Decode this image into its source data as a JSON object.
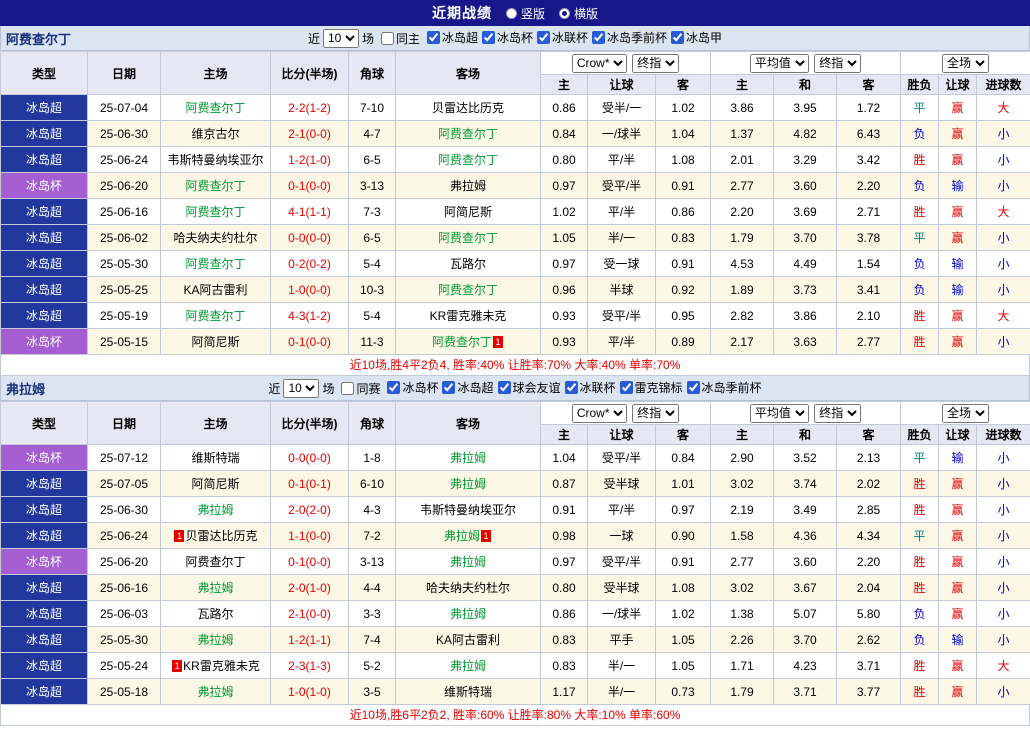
{
  "topbar": {
    "title": "近期战绩",
    "radio_vertical": "竖版",
    "radio_horizontal": "横版",
    "selected": "横版"
  },
  "table_headers": {
    "col_type": "类型",
    "col_date": "日期",
    "col_home": "主场",
    "col_score": "比分(半场)",
    "col_corner": "角球",
    "col_away": "客场",
    "grp1_select1": "Crow*",
    "grp1_select2": "终指",
    "grp1_sub": [
      "主",
      "让球",
      "客"
    ],
    "grp2_select1": "平均值",
    "grp2_select2": "终指",
    "grp2_sub": [
      "主",
      "和",
      "客"
    ],
    "grp3_select": "全场",
    "grp3_sub": [
      "胜负",
      "让球",
      "进球数"
    ]
  },
  "colors": {
    "league_super_bg": "#23389c",
    "league_cup_bg": "#a45ed2",
    "focus_team": "#009933",
    "win_red": "#e60000",
    "lose_blue": "#0000cc",
    "draw_teal": "#008080",
    "topbar_bg": "#17178a",
    "stripe_bg": "#fcf8e5"
  },
  "sections": [
    {
      "team": "阿费查尔丁",
      "filter": {
        "near_label": "近",
        "count": "10",
        "games_label": "场",
        "same_label": "同主",
        "same_checked": false,
        "leagues": [
          {
            "label": "冰岛超",
            "checked": true
          },
          {
            "label": "冰岛杯",
            "checked": true
          },
          {
            "label": "冰联杯",
            "checked": true
          },
          {
            "label": "冰岛季前杯",
            "checked": true
          },
          {
            "label": "冰岛甲",
            "checked": true
          }
        ]
      },
      "rows": [
        {
          "league": "冰岛超",
          "type": "super",
          "date": "25-07-04",
          "home": "阿费查尔丁",
          "home_focus": true,
          "score": "2-2(1-2)",
          "corners": "7-10",
          "away": "贝雷达比历克",
          "away_focus": false,
          "odds": [
            "0.86",
            "受半/一",
            "1.02"
          ],
          "avg": [
            "3.86",
            "3.95",
            "1.72"
          ],
          "results": [
            "平",
            "赢",
            "大"
          ]
        },
        {
          "league": "冰岛超",
          "type": "super",
          "date": "25-06-30",
          "home": "维京古尔",
          "home_focus": false,
          "score": "2-1(0-0)",
          "corners": "4-7",
          "away": "阿费查尔丁",
          "away_focus": true,
          "odds": [
            "0.84",
            "一/球半",
            "1.04"
          ],
          "avg": [
            "1.37",
            "4.82",
            "6.43"
          ],
          "results": [
            "负",
            "赢",
            "小"
          ]
        },
        {
          "league": "冰岛超",
          "type": "super",
          "date": "25-06-24",
          "home": "韦斯特曼纳埃亚尔",
          "home_focus": false,
          "score": "1-2(1-0)",
          "corners": "6-5",
          "away": "阿费查尔丁",
          "away_focus": true,
          "odds": [
            "0.80",
            "平/半",
            "1.08"
          ],
          "avg": [
            "2.01",
            "3.29",
            "3.42"
          ],
          "results": [
            "胜",
            "赢",
            "小"
          ]
        },
        {
          "league": "冰岛杯",
          "type": "cup",
          "date": "25-06-20",
          "home": "阿费查尔丁",
          "home_focus": true,
          "score": "0-1(0-0)",
          "corners": "3-13",
          "away": "弗拉姆",
          "away_focus": false,
          "odds": [
            "0.97",
            "受平/半",
            "0.91"
          ],
          "avg": [
            "2.77",
            "3.60",
            "2.20"
          ],
          "results": [
            "负",
            "输",
            "小"
          ]
        },
        {
          "league": "冰岛超",
          "type": "super",
          "date": "25-06-16",
          "home": "阿费查尔丁",
          "home_focus": true,
          "score": "4-1(1-1)",
          "corners": "7-3",
          "away": "阿简尼斯",
          "away_focus": false,
          "odds": [
            "1.02",
            "平/半",
            "0.86"
          ],
          "avg": [
            "2.20",
            "3.69",
            "2.71"
          ],
          "results": [
            "胜",
            "赢",
            "大"
          ]
        },
        {
          "league": "冰岛超",
          "type": "super",
          "date": "25-06-02",
          "home": "哈夫纳夫约杜尔",
          "home_focus": false,
          "score": "0-0(0-0)",
          "corners": "6-5",
          "away": "阿费查尔丁",
          "away_focus": true,
          "odds": [
            "1.05",
            "半/一",
            "0.83"
          ],
          "avg": [
            "1.79",
            "3.70",
            "3.78"
          ],
          "results": [
            "平",
            "赢",
            "小"
          ]
        },
        {
          "league": "冰岛超",
          "type": "super",
          "date": "25-05-30",
          "home": "阿费查尔丁",
          "home_focus": true,
          "score": "0-2(0-2)",
          "corners": "5-4",
          "away": "瓦路尔",
          "away_focus": false,
          "odds": [
            "0.97",
            "受一球",
            "0.91"
          ],
          "avg": [
            "4.53",
            "4.49",
            "1.54"
          ],
          "results": [
            "负",
            "输",
            "小"
          ]
        },
        {
          "league": "冰岛超",
          "type": "super",
          "date": "25-05-25",
          "home": "KA阿古雷利",
          "home_focus": false,
          "score": "1-0(0-0)",
          "corners": "10-3",
          "away": "阿费查尔丁",
          "away_focus": true,
          "odds": [
            "0.96",
            "半球",
            "0.92"
          ],
          "avg": [
            "1.89",
            "3.73",
            "3.41"
          ],
          "results": [
            "负",
            "输",
            "小"
          ]
        },
        {
          "league": "冰岛超",
          "type": "super",
          "date": "25-05-19",
          "home": "阿费查尔丁",
          "home_focus": true,
          "score": "4-3(1-2)",
          "corners": "5-4",
          "away": "KR雷克雅未克",
          "away_focus": false,
          "odds": [
            "0.93",
            "受平/半",
            "0.95"
          ],
          "avg": [
            "2.82",
            "3.86",
            "2.10"
          ],
          "results": [
            "胜",
            "赢",
            "大"
          ]
        },
        {
          "league": "冰岛杯",
          "type": "cup",
          "date": "25-05-15",
          "home": "阿简尼斯",
          "home_focus": false,
          "score": "0-1(0-0)",
          "corners": "11-3",
          "away": "阿费查尔丁",
          "away_focus": true,
          "away_badge_post": "1",
          "odds": [
            "0.93",
            "平/半",
            "0.89"
          ],
          "avg": [
            "2.17",
            "3.63",
            "2.77"
          ],
          "results": [
            "胜",
            "赢",
            "小"
          ]
        }
      ],
      "summary": "近10场,胜4平2负4, 胜率:40% 让胜率:70% 大率:40% 单率:70%"
    },
    {
      "team": "弗拉姆",
      "filter": {
        "near_label": "近",
        "count": "10",
        "games_label": "场",
        "same_label": "同赛",
        "same_checked": false,
        "leagues": [
          {
            "label": "冰岛杯",
            "checked": true
          },
          {
            "label": "冰岛超",
            "checked": true
          },
          {
            "label": "球会友谊",
            "checked": true
          },
          {
            "label": "冰联杯",
            "checked": true
          },
          {
            "label": "雷克锦标",
            "checked": true
          },
          {
            "label": "冰岛季前杯",
            "checked": true
          }
        ]
      },
      "rows": [
        {
          "league": "冰岛杯",
          "type": "cup",
          "date": "25-07-12",
          "home": "维斯特瑞",
          "home_focus": false,
          "score": "0-0(0-0)",
          "corners": "1-8",
          "away": "弗拉姆",
          "away_focus": true,
          "odds": [
            "1.04",
            "受平/半",
            "0.84"
          ],
          "avg": [
            "2.90",
            "3.52",
            "2.13"
          ],
          "results": [
            "平",
            "输",
            "小"
          ]
        },
        {
          "league": "冰岛超",
          "type": "super",
          "date": "25-07-05",
          "home": "阿简尼斯",
          "home_focus": false,
          "score": "0-1(0-1)",
          "corners": "6-10",
          "away": "弗拉姆",
          "away_focus": true,
          "odds": [
            "0.87",
            "受半球",
            "1.01"
          ],
          "avg": [
            "3.02",
            "3.74",
            "2.02"
          ],
          "results": [
            "胜",
            "赢",
            "小"
          ]
        },
        {
          "league": "冰岛超",
          "type": "super",
          "date": "25-06-30",
          "home": "弗拉姆",
          "home_focus": true,
          "score": "2-0(2-0)",
          "corners": "4-3",
          "away": "韦斯特曼纳埃亚尔",
          "away_focus": false,
          "odds": [
            "0.91",
            "平/半",
            "0.97"
          ],
          "avg": [
            "2.19",
            "3.49",
            "2.85"
          ],
          "results": [
            "胜",
            "赢",
            "小"
          ]
        },
        {
          "league": "冰岛超",
          "type": "super",
          "date": "25-06-24",
          "home": "贝雷达比历克",
          "home_focus": false,
          "home_badge_pre": "1",
          "score": "1-1(0-0)",
          "corners": "7-2",
          "away": "弗拉姆",
          "away_focus": true,
          "away_badge_post": "1",
          "odds": [
            "0.98",
            "一球",
            "0.90"
          ],
          "avg": [
            "1.58",
            "4.36",
            "4.34"
          ],
          "results": [
            "平",
            "赢",
            "小"
          ]
        },
        {
          "league": "冰岛杯",
          "type": "cup",
          "date": "25-06-20",
          "home": "阿费查尔丁",
          "home_focus": false,
          "score": "0-1(0-0)",
          "corners": "3-13",
          "away": "弗拉姆",
          "away_focus": true,
          "odds": [
            "0.97",
            "受平/半",
            "0.91"
          ],
          "avg": [
            "2.77",
            "3.60",
            "2.20"
          ],
          "results": [
            "胜",
            "赢",
            "小"
          ]
        },
        {
          "league": "冰岛超",
          "type": "super",
          "date": "25-06-16",
          "home": "弗拉姆",
          "home_focus": true,
          "score": "2-0(1-0)",
          "corners": "4-4",
          "away": "哈夫纳夫约杜尔",
          "away_focus": false,
          "odds": [
            "0.80",
            "受半球",
            "1.08"
          ],
          "avg": [
            "3.02",
            "3.67",
            "2.04"
          ],
          "results": [
            "胜",
            "赢",
            "小"
          ]
        },
        {
          "league": "冰岛超",
          "type": "super",
          "date": "25-06-03",
          "home": "瓦路尔",
          "home_focus": false,
          "score": "2-1(0-0)",
          "corners": "3-3",
          "away": "弗拉姆",
          "away_focus": true,
          "odds": [
            "0.86",
            "一/球半",
            "1.02"
          ],
          "avg": [
            "1.38",
            "5.07",
            "5.80"
          ],
          "results": [
            "负",
            "赢",
            "小"
          ]
        },
        {
          "league": "冰岛超",
          "type": "super",
          "date": "25-05-30",
          "home": "弗拉姆",
          "home_focus": true,
          "score": "1-2(1-1)",
          "corners": "7-4",
          "away": "KA阿古雷利",
          "away_focus": false,
          "odds": [
            "0.83",
            "平手",
            "1.05"
          ],
          "avg": [
            "2.26",
            "3.70",
            "2.62"
          ],
          "results": [
            "负",
            "输",
            "小"
          ]
        },
        {
          "league": "冰岛超",
          "type": "super",
          "date": "25-05-24",
          "home": "KR雷克雅未克",
          "home_focus": false,
          "home_badge_pre": "1",
          "score": "2-3(1-3)",
          "corners": "5-2",
          "away": "弗拉姆",
          "away_focus": true,
          "odds": [
            "0.83",
            "半/一",
            "1.05"
          ],
          "avg": [
            "1.71",
            "4.23",
            "3.71"
          ],
          "results": [
            "胜",
            "赢",
            "大"
          ]
        },
        {
          "league": "冰岛超",
          "type": "super",
          "date": "25-05-18",
          "home": "弗拉姆",
          "home_focus": true,
          "score": "1-0(1-0)",
          "corners": "3-5",
          "away": "维斯特瑞",
          "away_focus": false,
          "odds": [
            "1.17",
            "半/一",
            "0.73"
          ],
          "avg": [
            "1.79",
            "3.71",
            "3.77"
          ],
          "results": [
            "胜",
            "赢",
            "小"
          ]
        }
      ],
      "summary": "近10场,胜6平2负2, 胜率:60% 让胜率:80% 大率:10% 单率:60%"
    }
  ]
}
